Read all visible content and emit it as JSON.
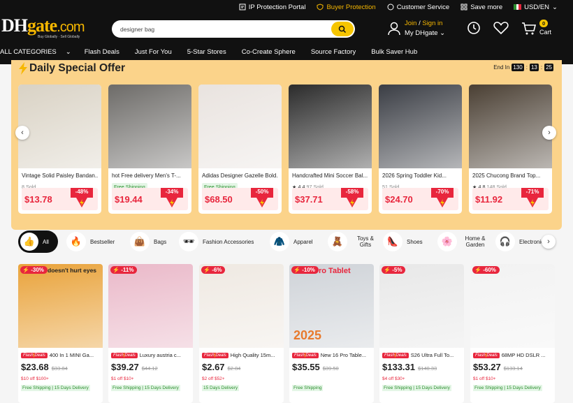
{
  "utility": {
    "ip": "IP Protection Portal",
    "buyer": "Buyer Protection",
    "service": "Customer Service",
    "save": "Save more",
    "lang": "USD/EN"
  },
  "logo": {
    "main": "DH",
    "mid": "gate",
    "suffix": ".com",
    "tag": "Buy Globally · Sell Globally"
  },
  "search": {
    "value": "designer bag"
  },
  "account": {
    "join": "Join",
    "sep": " / ",
    "signin": "Sign in",
    "my": "My DHgate"
  },
  "cart": {
    "count": "0",
    "label": "Cart"
  },
  "nav": [
    "ALL CATEGORIES",
    "Flash Deals",
    "Just For You",
    "5-Star Stores",
    "Co-Create Sphere",
    "Source Factory",
    "Bulk Saver Hub"
  ],
  "offer": {
    "title": "Daily Special Offer",
    "end_label": "End In",
    "h": "130",
    "m": "13",
    "s": "25"
  },
  "deals": [
    {
      "title": "Vintage Solid Paisley Bandan...",
      "sub": "8 Sold",
      "type": "sold",
      "price": "$13.78",
      "pct": "-48%",
      "color": "#d9d2c4"
    },
    {
      "title": "hot Free delivery Men's T-...",
      "sub": "Free Shipping",
      "type": "fs",
      "price": "$19.44",
      "pct": "-34%",
      "color": "#6d6b68"
    },
    {
      "title": "Adidas Designer Gazelle Bold...",
      "sub": "Free Shipping",
      "type": "fs",
      "price": "$68.50",
      "pct": "-50%",
      "color": "#e9e3df"
    },
    {
      "title": "Handcrafted Mini Soccer Bal...",
      "rating": "4.4",
      "sub": "97 Sold",
      "type": "rating",
      "price": "$37.71",
      "pct": "-58%",
      "color": "#2b2b2b"
    },
    {
      "title": "2026 Spring Toddler Kid...",
      "sub": "51 Sold",
      "type": "sold",
      "price": "$24.70",
      "pct": "-70%",
      "color": "#3a3d44"
    },
    {
      "title": "2025 Chucong Brand Top...",
      "rating": "4.8",
      "sub": "148 Sold",
      "type": "rating",
      "price": "$11.92",
      "pct": "-71%",
      "color": "#4a3f33"
    }
  ],
  "categories": [
    {
      "label": "All",
      "icon": "👍"
    },
    {
      "label": "Bestseller",
      "icon": "🔥"
    },
    {
      "label": "Bags",
      "icon": "👜"
    },
    {
      "label": "Fashion Accessories",
      "icon": "🕶"
    },
    {
      "label": "Apparel",
      "icon": "🧥"
    },
    {
      "label": "Toys & Gifts",
      "icon": "🧸"
    },
    {
      "label": "Shoes",
      "icon": "👠"
    },
    {
      "label": "Home & Garden",
      "icon": "🌸"
    },
    {
      "label": "Electronics",
      "icon": "🎧"
    }
  ],
  "products": [
    {
      "disc": "-30%",
      "flash1": "Flash",
      "flash2": "Deals",
      "title": "400 In 1 MINI Ga...",
      "price": "$23.68",
      "old": "$33.84",
      "coupon": "$10 off $100+",
      "ship": "Free Shipping | 15 Days Delivery",
      "overlay": "doesn't hurt eyes",
      "color": "#e9a33b"
    },
    {
      "disc": "-11%",
      "flash1": "Flash",
      "flash2": "Deals",
      "title": "Luxury austria c...",
      "price": "$39.27",
      "old": "$44.12",
      "coupon": "$1 off $10+",
      "ship": "Free Shipping | 15 Days Delivery",
      "overlay": "",
      "color": "#eab9c9"
    },
    {
      "disc": "-6%",
      "flash1": "Flash",
      "flash2": "Deals",
      "title": "High Quality 15m...",
      "price": "$2.67",
      "old": "$2.84",
      "coupon": "$2 off $52+",
      "ship": "15 Days Delivery",
      "overlay": "",
      "color": "#efe9e2"
    },
    {
      "disc": "-10%",
      "flash1": "Flash",
      "flash2": "Deals",
      "title": "New 16 Pro Table...",
      "price": "$35.55",
      "old": "$39.50",
      "coupon": "",
      "ship": "Free Shipping",
      "overlay": "ro Tablet",
      "year": "2025",
      "color": "#cfd3d8"
    },
    {
      "disc": "-5%",
      "flash1": "Flash",
      "flash2": "Deals",
      "title": "S26 Ultra Full To...",
      "price": "$133.31",
      "old": "$140.33",
      "coupon": "$4 off $30+",
      "ship": "Free Shipping | 15 Days Delivery",
      "overlay": "",
      "color": "#e8e8e8"
    },
    {
      "disc": "-60%",
      "flash1": "Flash",
      "flash2": "Deals",
      "title": "68MP HD DSLR ...",
      "price": "$53.27",
      "old": "$133.14",
      "coupon": "$1 off $10+",
      "ship": "Free Shipping | 15 Days Delivery",
      "overlay": "",
      "color": "#f2f2f2"
    }
  ]
}
